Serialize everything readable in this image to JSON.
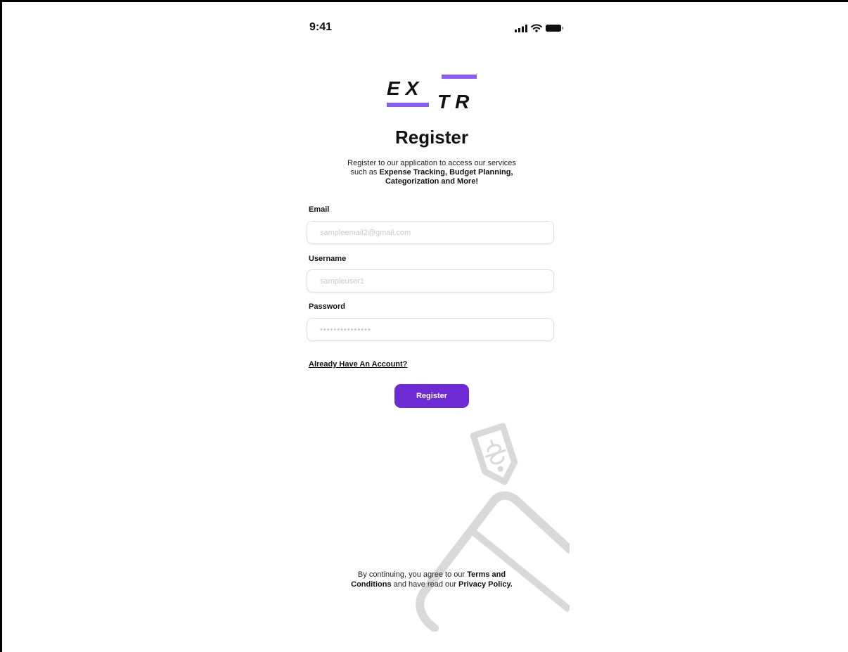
{
  "status_bar": {
    "time": "9:41"
  },
  "logo": {
    "line1": "EX",
    "line2": "TR",
    "accent_color": "#8b5cf6"
  },
  "header": {
    "title": "Register",
    "subtitle_plain": "Register to our application to access our services such as ",
    "subtitle_bold": "Expense Tracking, Budget Planning, Categorization and More!"
  },
  "form": {
    "email": {
      "label": "Email",
      "placeholder": "sampleemail2@gmail.com"
    },
    "username": {
      "label": "Username",
      "placeholder": "sampleuser1"
    },
    "password": {
      "label": "Password",
      "placeholder": "•••••••••••••••"
    }
  },
  "login_link": "Already Have An Account?",
  "register_button": {
    "label": "Register",
    "color": "#6d2bd3"
  },
  "terms": {
    "part1": "By continuing, you agree to our ",
    "terms_link": "Terms and Conditions",
    "part2": " and have read our ",
    "privacy_link": "Privacy Policy",
    "part3": "."
  }
}
